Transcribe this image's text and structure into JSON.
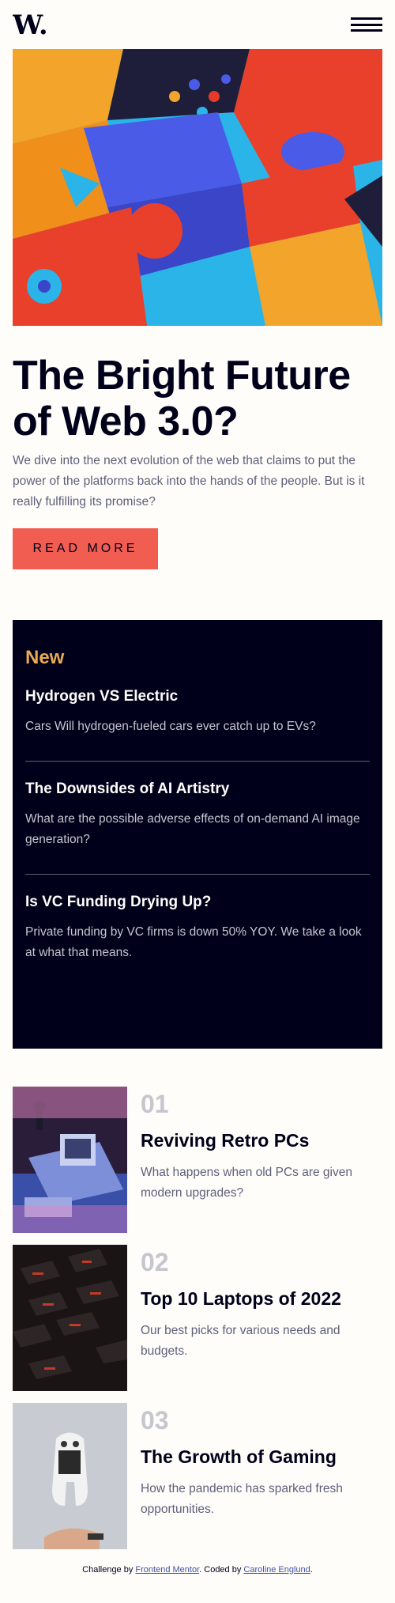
{
  "header": {
    "logo_alt": "W.",
    "menu_icon": "hamburger-icon"
  },
  "hero": {
    "title": "The Bright Future of Web 3.0?",
    "text": "We dive into the next evolution of the web that claims to put the power of the platforms back into the hands of the people. But is it really fulfilling its promise?",
    "button_label": "Read more"
  },
  "new": {
    "heading": "New",
    "items": [
      {
        "title": "Hydrogen VS Electric",
        "text": "Cars Will hydrogen-fueled cars ever catch up to EVs?"
      },
      {
        "title": "The Downsides of AI Artistry",
        "text": "What are the possible adverse effects of on-demand AI image generation?"
      },
      {
        "title": "Is VC Funding Drying Up?",
        "text": "Private funding by VC firms is down 50% YOY. We take a look at what that means."
      }
    ]
  },
  "list": [
    {
      "num": "01",
      "title": "Reviving Retro PCs",
      "text": "What happens when old PCs are given modern upgrades?"
    },
    {
      "num": "02",
      "title": "Top 10 Laptops of 2022",
      "text": "Our best picks for various needs and budgets."
    },
    {
      "num": "03",
      "title": "The Growth of Gaming",
      "text": "How the pandemic has sparked fresh opportunities."
    }
  ],
  "footer": {
    "prefix": "Challenge by ",
    "link1": "Frontend Mentor",
    "middle": ". Coded by ",
    "link2": "Caroline Englund",
    "suffix": "."
  },
  "colors": {
    "accent": "#f15d51",
    "dark": "#00001a",
    "gold": "#e9ab53"
  }
}
